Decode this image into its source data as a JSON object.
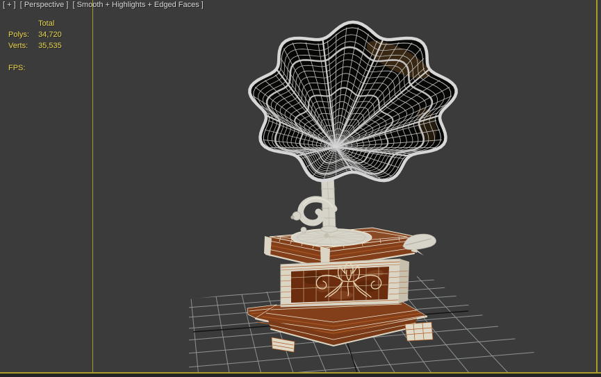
{
  "viewport_label": {
    "plus": "[ + ]",
    "view": "[ Perspective ]",
    "shading": "[ Smooth + Highlights + Edged Faces ]"
  },
  "statistics": {
    "header": "Total",
    "rows": [
      {
        "label": "Polys:",
        "value": "34,720"
      },
      {
        "label": "Verts:",
        "value": "35,535"
      }
    ],
    "fps_label": "FPS:"
  },
  "colors": {
    "background": "#3b3b3b",
    "frame_bottom": "#242424",
    "border": "#ab9d28",
    "label_text": "#d8d8d8",
    "stats_text": "#e8d44c",
    "grid": "#9a9f9f",
    "axis": "#121212",
    "wire": "#efe7d4",
    "wire_orange": "#b05a22",
    "wire_soft": "#d9c6a4",
    "ornament": "#ead9b8",
    "wood_top": "#8a4a26",
    "wood_band": "#833f1a",
    "wood_step": "#7a3a17",
    "wood_panel": "#6b2d0e",
    "wood_blotch_dark": "#4e1f07",
    "wood_blotch_light": "#93502a",
    "cream": "#dbd5c6",
    "cream_dark": "#c6bfae",
    "cream_light": "#e0dac9",
    "cream_lip": "#ddd5c3",
    "metal": "#d6d3c9",
    "metal_dark": "#b6b3a9",
    "metal_hi": "#efece2",
    "horn_black": "#070705",
    "horn_rim": "#d7d7d7",
    "horn_wire": "#c9c9c9",
    "sheen": "#3e2b14"
  }
}
